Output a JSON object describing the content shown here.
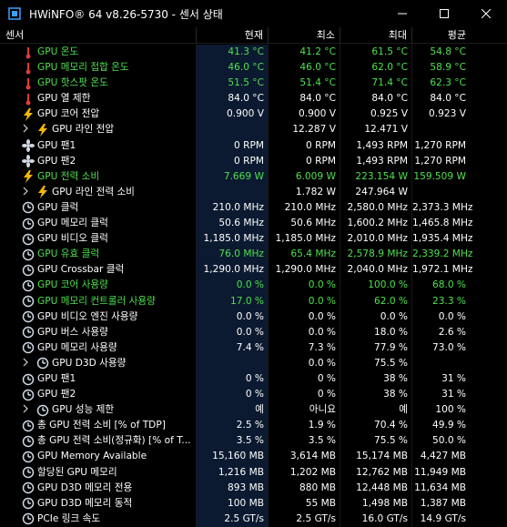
{
  "window": {
    "title": "HWiNFO® 64 v8.26-5730 - 센서 상태"
  },
  "columns": {
    "name": "센서",
    "current": "현재",
    "min": "최소",
    "max": "최대",
    "avg": "평균"
  },
  "rows": [
    {
      "label": "GPU 온도",
      "icon": "thermometer-icon",
      "cur": "41.3 °C",
      "min": "41.2 °C",
      "max": "61.5 °C",
      "avg": "54.8 °C",
      "green": true
    },
    {
      "label": "GPU 메모리 접합 온도",
      "icon": "thermometer-icon",
      "cur": "46.0 °C",
      "min": "46.0 °C",
      "max": "62.0 °C",
      "avg": "58.9 °C",
      "green": true
    },
    {
      "label": "GPU 핫스팟 온도",
      "icon": "thermometer-icon",
      "cur": "51.5 °C",
      "min": "51.4 °C",
      "max": "71.4 °C",
      "avg": "62.3 °C",
      "green": true
    },
    {
      "label": "GPU 열 제한",
      "icon": "thermometer-icon",
      "cur": "84.0 °C",
      "min": "84.0 °C",
      "max": "84.0 °C",
      "avg": "84.0 °C",
      "green": false
    },
    {
      "label": "GPU 코어 전압",
      "icon": "lightning-icon",
      "cur": "0.900 V",
      "min": "0.900 V",
      "max": "0.925 V",
      "avg": "0.923 V",
      "green": false
    },
    {
      "label": "GPU 라인 전압",
      "icon": "lightning-icon",
      "expander": true,
      "cur": "",
      "min": "12.287 V",
      "max": "12.471 V",
      "avg": "",
      "green": false
    },
    {
      "label": "GPU 팬1",
      "icon": "fan-icon",
      "cur": "0 RPM",
      "min": "0 RPM",
      "max": "1,493 RPM",
      "avg": "1,270 RPM",
      "green": false
    },
    {
      "label": "GPU 팬2",
      "icon": "fan-icon",
      "cur": "0 RPM",
      "min": "0 RPM",
      "max": "1,493 RPM",
      "avg": "1,270 RPM",
      "green": false
    },
    {
      "label": "GPU 전력 소비",
      "icon": "lightning-icon",
      "cur": "7.669 W",
      "min": "6.009 W",
      "max": "223.154 W",
      "avg": "159.509 W",
      "green": true
    },
    {
      "label": "GPU 라인 전력 소비",
      "icon": "lightning-icon",
      "expander": true,
      "cur": "",
      "min": "1.782 W",
      "max": "247.964 W",
      "avg": "",
      "green": false
    },
    {
      "label": "GPU 클럭",
      "icon": "clock-icon",
      "cur": "210.0 MHz",
      "min": "210.0 MHz",
      "max": "2,580.0 MHz",
      "avg": "2,373.3 MHz",
      "green": false
    },
    {
      "label": "GPU 메모리 클럭",
      "icon": "clock-icon",
      "cur": "50.6 MHz",
      "min": "50.6 MHz",
      "max": "1,600.2 MHz",
      "avg": "1,465.8 MHz",
      "green": false
    },
    {
      "label": "GPU 비디오 클럭",
      "icon": "clock-icon",
      "cur": "1,185.0 MHz",
      "min": "1,185.0 MHz",
      "max": "2,010.0 MHz",
      "avg": "1,935.4 MHz",
      "green": false
    },
    {
      "label": "GPU 유효 클럭",
      "icon": "clock-icon",
      "cur": "76.0 MHz",
      "min": "65.4 MHz",
      "max": "2,578.9 MHz",
      "avg": "2,339.2 MHz",
      "green": true
    },
    {
      "label": "GPU Crossbar 클럭",
      "icon": "clock-icon",
      "cur": "1,290.0 MHz",
      "min": "1,290.0 MHz",
      "max": "2,040.0 MHz",
      "avg": "1,972.1 MHz",
      "green": false
    },
    {
      "label": "GPU 코어 사용량",
      "icon": "clock-icon",
      "cur": "0.0 %",
      "min": "0.0 %",
      "max": "100.0 %",
      "avg": "68.0 %",
      "green": true
    },
    {
      "label": "GPU 메모리 컨트롤러 사용량",
      "icon": "clock-icon",
      "cur": "17.0 %",
      "min": "0.0 %",
      "max": "62.0 %",
      "avg": "23.3 %",
      "green": true
    },
    {
      "label": "GPU 비디오 엔진 사용량",
      "icon": "clock-icon",
      "cur": "0.0 %",
      "min": "0.0 %",
      "max": "0.0 %",
      "avg": "0.0 %",
      "green": false
    },
    {
      "label": "GPU 버스 사용량",
      "icon": "clock-icon",
      "cur": "0.0 %",
      "min": "0.0 %",
      "max": "18.0 %",
      "avg": "2.6 %",
      "green": false
    },
    {
      "label": "GPU 메모리 사용량",
      "icon": "clock-icon",
      "cur": "7.4 %",
      "min": "7.3 %",
      "max": "77.9 %",
      "avg": "73.0 %",
      "green": false
    },
    {
      "label": "GPU D3D 사용량",
      "icon": "clock-icon",
      "expander": true,
      "cur": "",
      "min": "0.0 %",
      "max": "75.5 %",
      "avg": "",
      "green": false
    },
    {
      "label": "GPU 팬1",
      "icon": "clock-icon",
      "cur": "0 %",
      "min": "0 %",
      "max": "38 %",
      "avg": "31 %",
      "green": false
    },
    {
      "label": "GPU 팬2",
      "icon": "clock-icon",
      "cur": "0 %",
      "min": "0 %",
      "max": "38 %",
      "avg": "31 %",
      "green": false
    },
    {
      "label": "GPU 성능 제한",
      "icon": "clock-icon",
      "expander": true,
      "cur": "예",
      "min": "아니요",
      "max": "예",
      "avg": "100 %",
      "green": false
    },
    {
      "label": "총 GPU 전력 소비 [% of TDP]",
      "icon": "clock-icon",
      "cur": "2.5 %",
      "min": "1.9 %",
      "max": "70.4 %",
      "avg": "49.9 %",
      "green": false
    },
    {
      "label": "총 GPU 전력 소비(정규화) [% of T...",
      "icon": "clock-icon",
      "cur": "3.5 %",
      "min": "3.5 %",
      "max": "75.5 %",
      "avg": "50.0 %",
      "green": false
    },
    {
      "label": "GPU Memory Available",
      "icon": "clock-icon",
      "cur": "15,160 MB",
      "min": "3,614 MB",
      "max": "15,174 MB",
      "avg": "4,427 MB",
      "green": false
    },
    {
      "label": "할당된 GPU 메모리",
      "icon": "clock-icon",
      "cur": "1,216 MB",
      "min": "1,202 MB",
      "max": "12,762 MB",
      "avg": "11,949 MB",
      "green": false
    },
    {
      "label": "GPU D3D 메모리 전용",
      "icon": "clock-icon",
      "cur": "893 MB",
      "min": "880 MB",
      "max": "12,448 MB",
      "avg": "11,634 MB",
      "green": false
    },
    {
      "label": "GPU D3D 메모리 동적",
      "icon": "clock-icon",
      "cur": "100 MB",
      "min": "55 MB",
      "max": "1,498 MB",
      "avg": "1,387 MB",
      "green": false
    },
    {
      "label": "PCIe 링크 속도",
      "icon": "clock-icon",
      "cur": "2.5 GT/s",
      "min": "2.5 GT/s",
      "max": "16.0 GT/s",
      "avg": "14.9 GT/s",
      "green": false
    }
  ],
  "colors": {
    "green": "#4ee04e",
    "thermo": "#e03a3a",
    "bolt": "#f5b800",
    "selected_bg": "#0b1a30"
  }
}
